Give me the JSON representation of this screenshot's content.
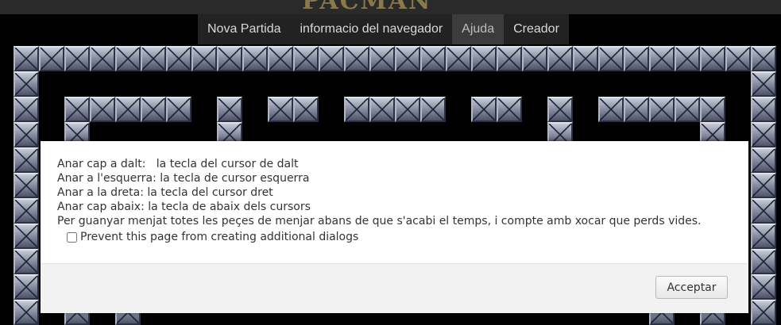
{
  "header": {
    "logo_text": "PACMAN",
    "menu": [
      {
        "label": "Nova Partida",
        "active": false
      },
      {
        "label": "informacio del navegador",
        "active": false
      },
      {
        "label": "Ajuda",
        "active": true
      },
      {
        "label": "Creador",
        "active": false
      }
    ]
  },
  "dialog": {
    "lines": [
      "Anar cap a dalt:   la tecla del cursor de dalt",
      "Anar a l'esquerra: la tecla de cursor esquerra",
      "Anar a la dreta: la tecla del cursor dret",
      "Anar cap abaix: la tecla de abaix dels cursors",
      "Per guanyar menjat totes les peçes de menjar abans de que s'acabi el temps, i compte amb xocar que perds vides."
    ],
    "prevent_label": "Prevent this page from creating additional dialogs",
    "prevent_checked": false,
    "accept_label": "Acceptar"
  }
}
